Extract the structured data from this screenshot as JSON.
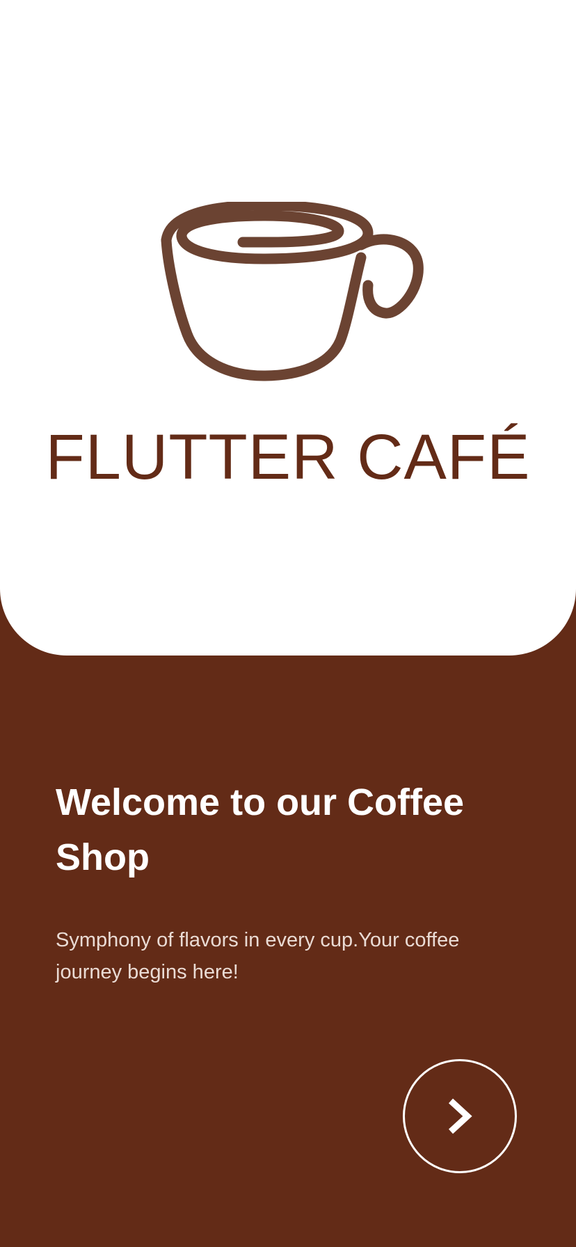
{
  "brand": {
    "title": "FLUTTER CAFÉ",
    "logo_icon": "coffee-cup-icon",
    "logo_color": "#6b4332"
  },
  "welcome": {
    "heading": "Welcome to our Coffee Shop",
    "description": "Symphony of flavors in every cup.Your coffee journey begins here!"
  },
  "actions": {
    "next_icon": "chevron-right-icon"
  },
  "colors": {
    "background": "#632b17",
    "card": "#ffffff",
    "title_text": "#632b17",
    "body_text": "#eadbd4"
  }
}
